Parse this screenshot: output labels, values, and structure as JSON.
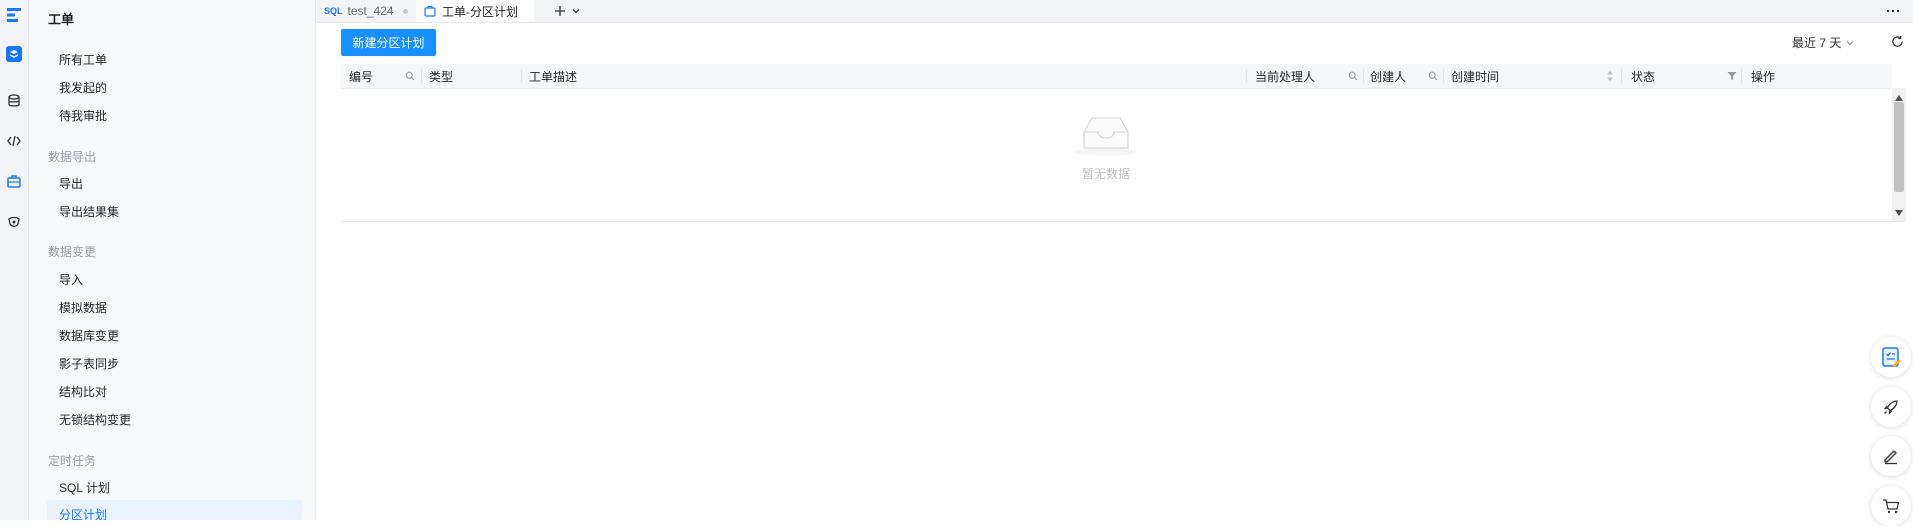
{
  "sidebar": {
    "title": "工单",
    "items_top": [
      "所有工单",
      "我发起的",
      "待我审批"
    ],
    "groups": [
      {
        "label": "数据导出",
        "items": [
          "导出",
          "导出结果集"
        ]
      },
      {
        "label": "数据变更",
        "items": [
          "导入",
          "模拟数据",
          "数据库变更",
          "影子表同步",
          "结构比对",
          "无锁结构变更"
        ]
      },
      {
        "label": "定时任务",
        "items": [
          "SQL 计划",
          "分区计划"
        ]
      }
    ]
  },
  "tabs": [
    {
      "icon": "SQL",
      "label": "test_424"
    },
    {
      "label": "工单-分区计划"
    }
  ],
  "toolbar": {
    "create_button": "新建分区计划",
    "date_filter": "最近 7 天"
  },
  "table": {
    "columns": [
      "编号",
      "类型",
      "工单描述",
      "当前处理人",
      "创建人",
      "创建时间",
      "状态",
      "操作"
    ],
    "empty_text": "暂无数据"
  },
  "colors": {
    "accent": "#1890ff",
    "logo_blue": "#1677ff"
  }
}
